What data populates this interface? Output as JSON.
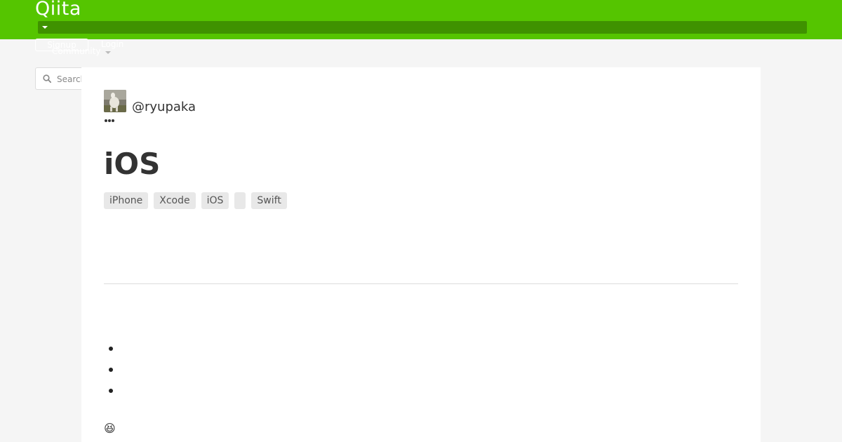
{
  "header": {
    "logo": "Qiita",
    "signup_label": "Signup",
    "login_label": "Login",
    "community_label": "Community"
  },
  "search": {
    "placeholder": "Search"
  },
  "article": {
    "author": "@ryupaka",
    "title": "iOS",
    "tags": [
      "iPhone",
      "Xcode",
      "iOS",
      "",
      "Swift"
    ],
    "emoji": "😆"
  },
  "colors": {
    "brand": "#55c500",
    "header_bar": "#3f9200"
  }
}
